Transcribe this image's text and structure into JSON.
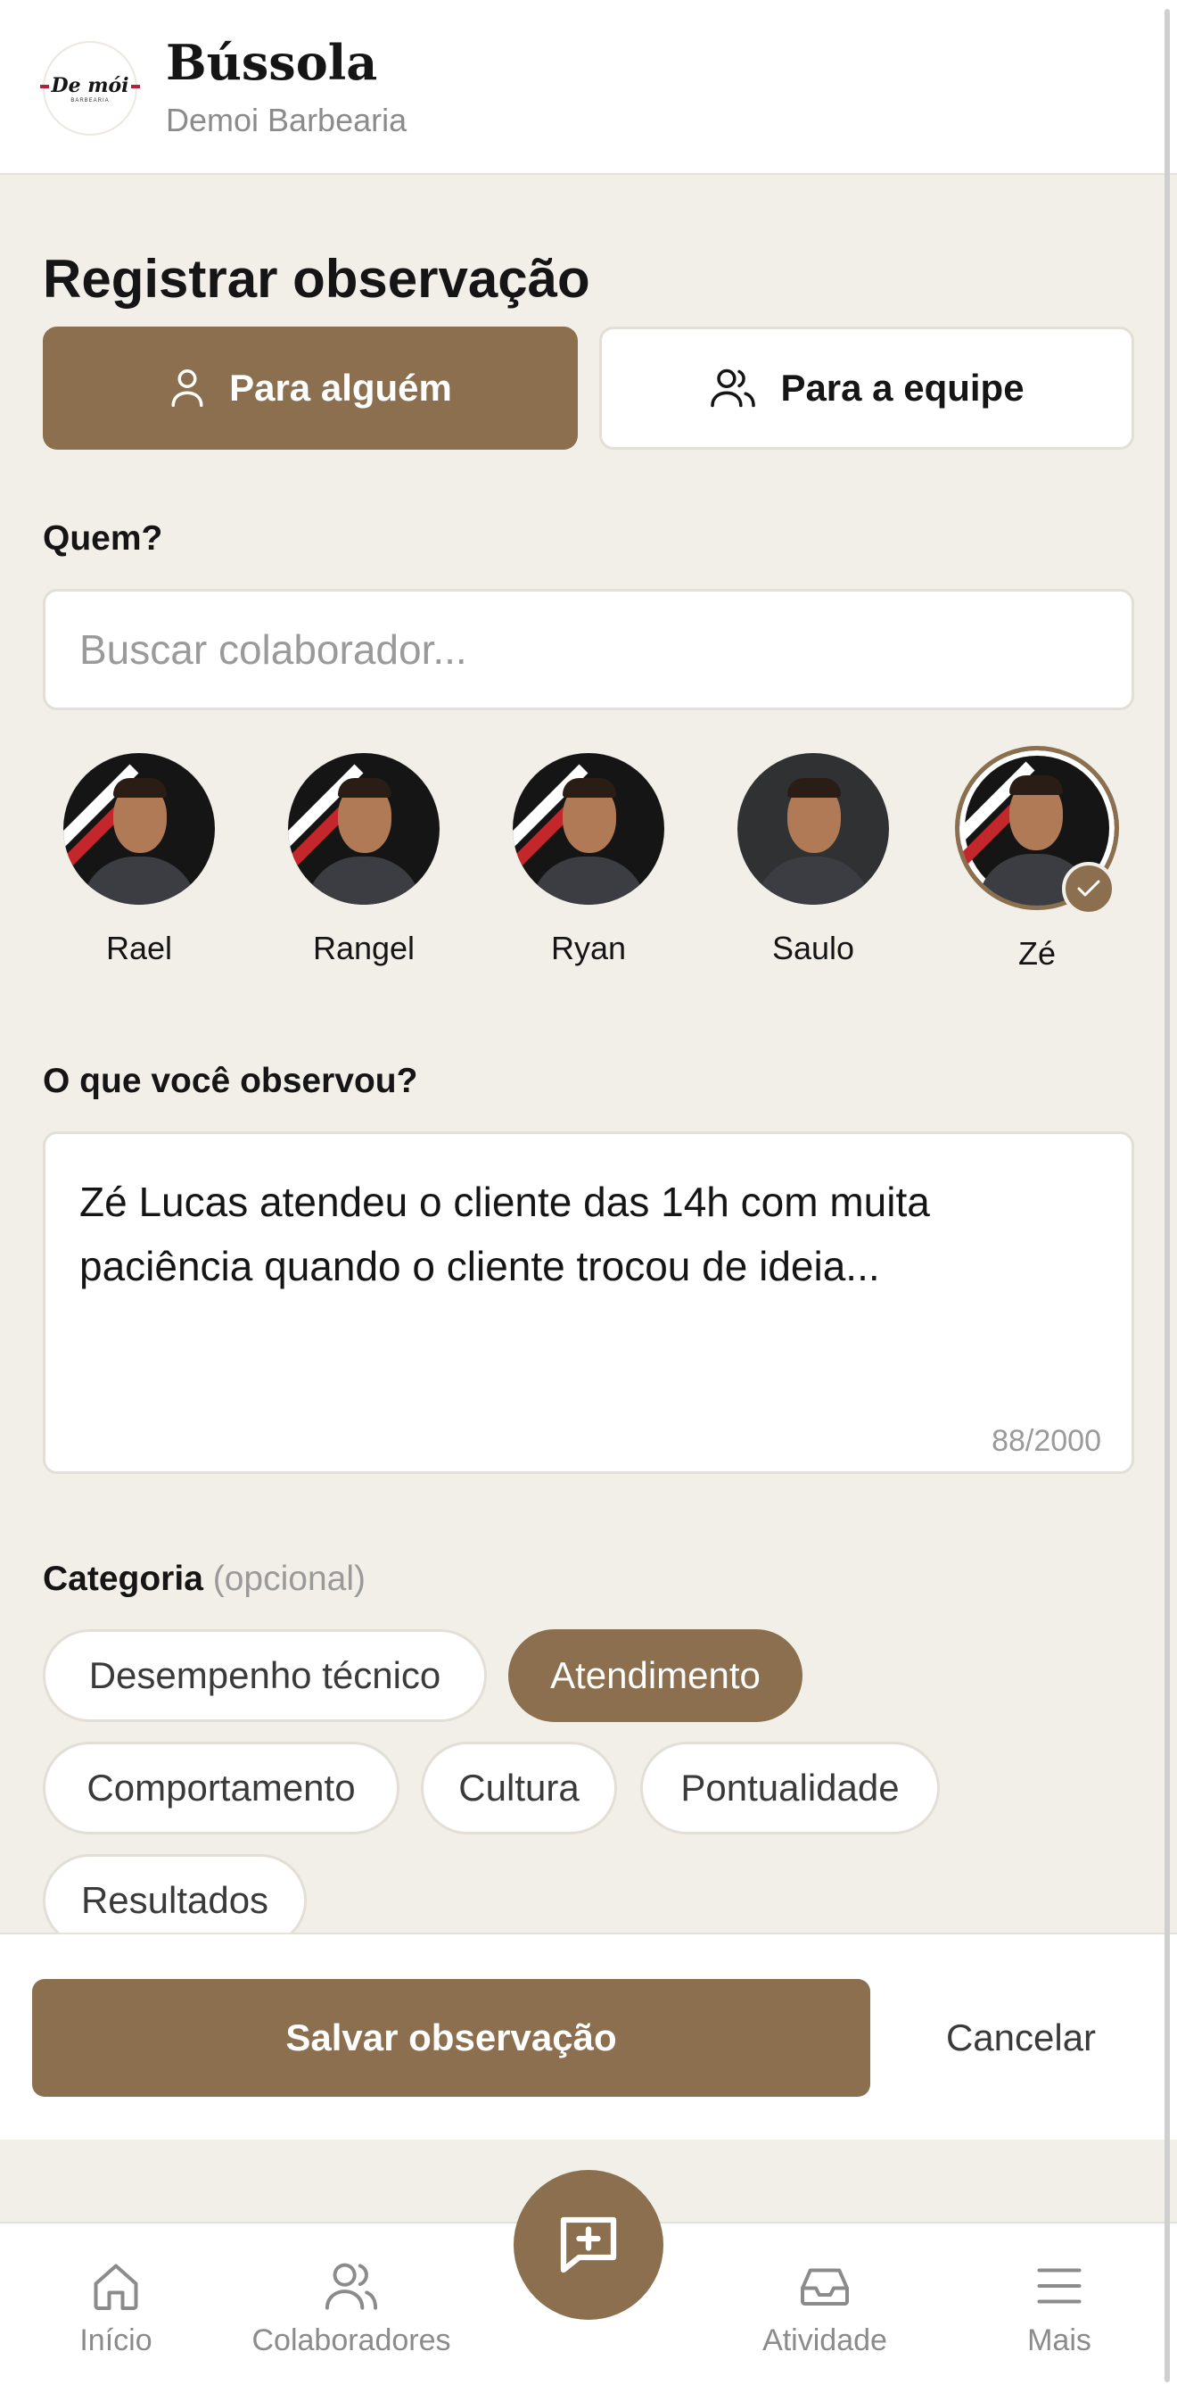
{
  "header": {
    "logo_text": "De mói",
    "logo_sub": "BARBEARIA",
    "title": "Bússola",
    "subtitle": "Demoi Barbearia"
  },
  "page_title": "Registrar observação",
  "mode_tabs": [
    {
      "label": "Para alguém",
      "icon": "user-icon",
      "active": true
    },
    {
      "label": "Para a equipe",
      "icon": "users-icon",
      "active": false
    }
  ],
  "who": {
    "label": "Quem?",
    "search_placeholder": "Buscar colaborador..."
  },
  "people": [
    {
      "name": "Rael",
      "selected": false
    },
    {
      "name": "Rangel",
      "selected": false
    },
    {
      "name": "Ryan",
      "selected": false
    },
    {
      "name": "Saulo",
      "selected": false
    },
    {
      "name": "Zé",
      "selected": true
    }
  ],
  "observation": {
    "label": "O que você observou?",
    "text": "Zé Lucas atendeu o cliente das 14h com muita paciência quando o cliente trocou de ideia...",
    "counter": "88/2000"
  },
  "category": {
    "label": "Categoria",
    "optional": "(opcional)",
    "chips": [
      {
        "label": "Desempenho técnico",
        "active": false
      },
      {
        "label": "Atendimento",
        "active": true
      },
      {
        "label": "Comportamento",
        "active": false
      },
      {
        "label": "Cultura",
        "active": false
      },
      {
        "label": "Pontualidade",
        "active": false
      },
      {
        "label": "Resultados",
        "active": false
      }
    ]
  },
  "actions": {
    "save": "Salvar observação",
    "cancel": "Cancelar"
  },
  "nav": [
    {
      "label": "Início",
      "icon": "home-icon"
    },
    {
      "label": "Colaboradores",
      "icon": "users-icon"
    },
    {
      "label": "Atividade",
      "icon": "inbox-icon"
    },
    {
      "label": "Mais",
      "icon": "menu-icon"
    }
  ],
  "fab_icon": "message-plus-icon",
  "colors": {
    "accent": "#8b6f4e",
    "background": "#f2efe9"
  }
}
